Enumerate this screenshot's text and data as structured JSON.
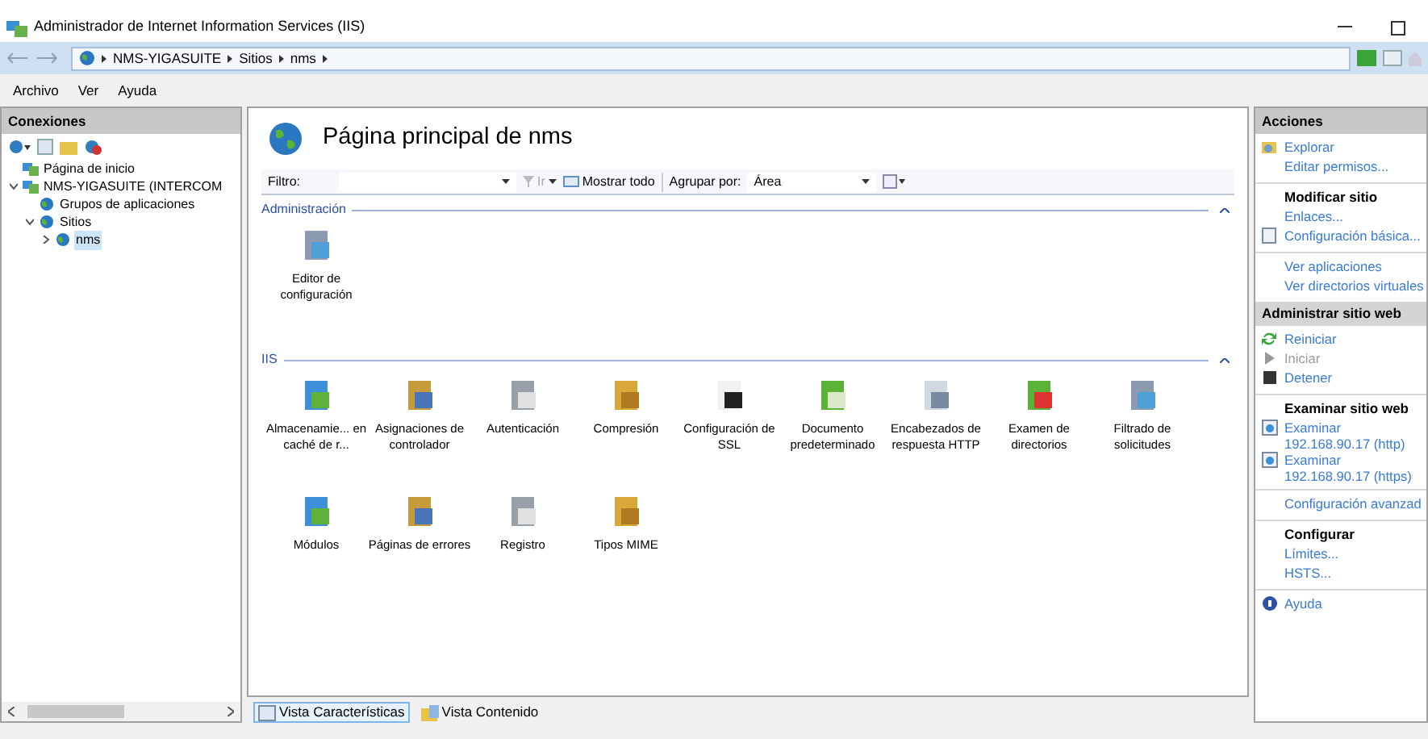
{
  "window": {
    "title": "Administrador de Internet Information Services (IIS)"
  },
  "address_bar": {
    "crumbs": [
      "NMS-YIGASUITE",
      "Sitios",
      "nms"
    ]
  },
  "menu": [
    "Archivo",
    "Ver",
    "Ayuda"
  ],
  "connections": {
    "title": "Conexiones",
    "tree": [
      {
        "label": "Página de inicio",
        "selected": false
      },
      {
        "label": "NMS-YIGASUITE (INTERCOM",
        "selected": false,
        "expanded": true,
        "children": [
          {
            "label": "Grupos de aplicaciones",
            "selected": false
          },
          {
            "label": "Sitios",
            "selected": false,
            "expanded": true,
            "children": [
              {
                "label": "nms",
                "selected": true,
                "expanded": false
              }
            ]
          }
        ]
      }
    ]
  },
  "main": {
    "title": "Página principal de nms",
    "filter": {
      "label": "Filtro:",
      "go": "Ir",
      "show_all": "Mostrar todo",
      "group_by_label": "Agrupar por:",
      "group_by_value": "Área"
    },
    "groups": [
      {
        "name": "Administración",
        "expanded": true,
        "features": [
          "Editor de configuración"
        ]
      },
      {
        "name": "IIS",
        "expanded": true,
        "features": [
          "Almacenamie... en caché de r...",
          "Asignaciones de controlador",
          "Autenticación",
          "Compresión",
          "Configuración de SSL",
          "Documento predeterminado",
          "Encabezados de respuesta HTTP",
          "Examen de directorios",
          "Filtrado de solicitudes",
          "Módulos",
          "Páginas de errores",
          "Registro",
          "Tipos MIME"
        ]
      }
    ],
    "views": [
      {
        "label": "Vista Características",
        "selected": true
      },
      {
        "label": "Vista Contenido",
        "selected": false
      }
    ]
  },
  "actions": {
    "title": "Acciones",
    "sections": [
      {
        "items": [
          {
            "kind": "explore",
            "label": "Explorar",
            "disabled": false
          },
          {
            "kind": "link",
            "label": "Editar permisos...",
            "disabled": false
          }
        ]
      },
      {
        "items": [
          {
            "kind": "heading",
            "label": "Modificar sitio",
            "disabled": false
          },
          {
            "kind": "link",
            "label": "Enlaces...",
            "disabled": false
          },
          {
            "kind": "settings",
            "label": "Configuración básica...",
            "disabled": false
          }
        ]
      },
      {
        "items": [
          {
            "kind": "link",
            "label": "Ver aplicaciones",
            "disabled": false
          },
          {
            "kind": "link",
            "label": "Ver directorios virtuales",
            "disabled": false
          }
        ]
      },
      {
        "band": "Administrar sitio web",
        "items": [
          {
            "kind": "restart",
            "label": "Reiniciar",
            "disabled": false
          },
          {
            "kind": "start",
            "label": "Iniciar",
            "disabled": true
          },
          {
            "kind": "stop",
            "label": "Detener",
            "disabled": false
          }
        ]
      },
      {
        "items": [
          {
            "kind": "heading",
            "label": "Examinar sitio web",
            "disabled": false
          },
          {
            "kind": "browse",
            "label": "Examinar 192.168.90.17 (http)",
            "disabled": false
          },
          {
            "kind": "browse",
            "label": "Examinar 192.168.90.17 (https)",
            "disabled": false
          }
        ]
      },
      {
        "items": [
          {
            "kind": "link",
            "label": "Configuración avanzad",
            "disabled": false
          }
        ]
      },
      {
        "items": [
          {
            "kind": "heading",
            "label": "Configurar",
            "disabled": false
          },
          {
            "kind": "link",
            "label": "Límites...",
            "disabled": false
          },
          {
            "kind": "link",
            "label": "HSTS...",
            "disabled": false
          }
        ]
      },
      {
        "items": [
          {
            "kind": "help",
            "label": "Ayuda",
            "disabled": false
          }
        ]
      }
    ]
  }
}
